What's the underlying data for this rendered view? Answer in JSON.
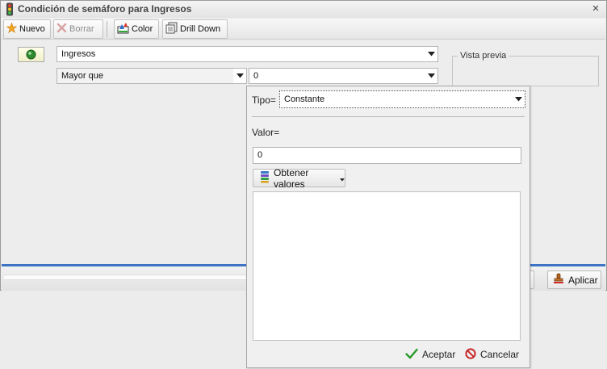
{
  "window": {
    "title": "Condición de semáforo para Ingresos",
    "close_glyph": "×"
  },
  "toolbar": {
    "new_label": "Nuevo",
    "delete_label": "Borrar",
    "color_label": "Color",
    "drilldown_label": "Drill Down"
  },
  "condition": {
    "field_value": "Ingresos",
    "operator_value": "Mayor que",
    "compare_value": "0"
  },
  "preview": {
    "legend": "Vista previa"
  },
  "footer": {
    "apply_label": "Aplicar"
  },
  "popup": {
    "type_label": "Tipo=",
    "type_value": "Constante",
    "value_label": "Valor=",
    "value_input": "0",
    "get_values_label": "Obtener valores",
    "accept_label": "Aceptar",
    "cancel_label": "Cancelar"
  },
  "icons": {
    "traffic_light": "traffic-light-icon",
    "new": "new-star-icon",
    "delete": "delete-x-icon",
    "color": "color-palette-icon",
    "drilldown": "drill-down-icon",
    "status": "green-status-icon",
    "dropdown": "chevron-down-icon",
    "get_values": "database-icon",
    "accept": "check-icon",
    "cancel": "cancel-icon",
    "apply": "stamp-icon"
  },
  "colors": {
    "accent_blue": "#3d74c6",
    "status_green": "#2e8b2e",
    "accept_green": "#2b9a2b",
    "cancel_red": "#c82a2a"
  }
}
